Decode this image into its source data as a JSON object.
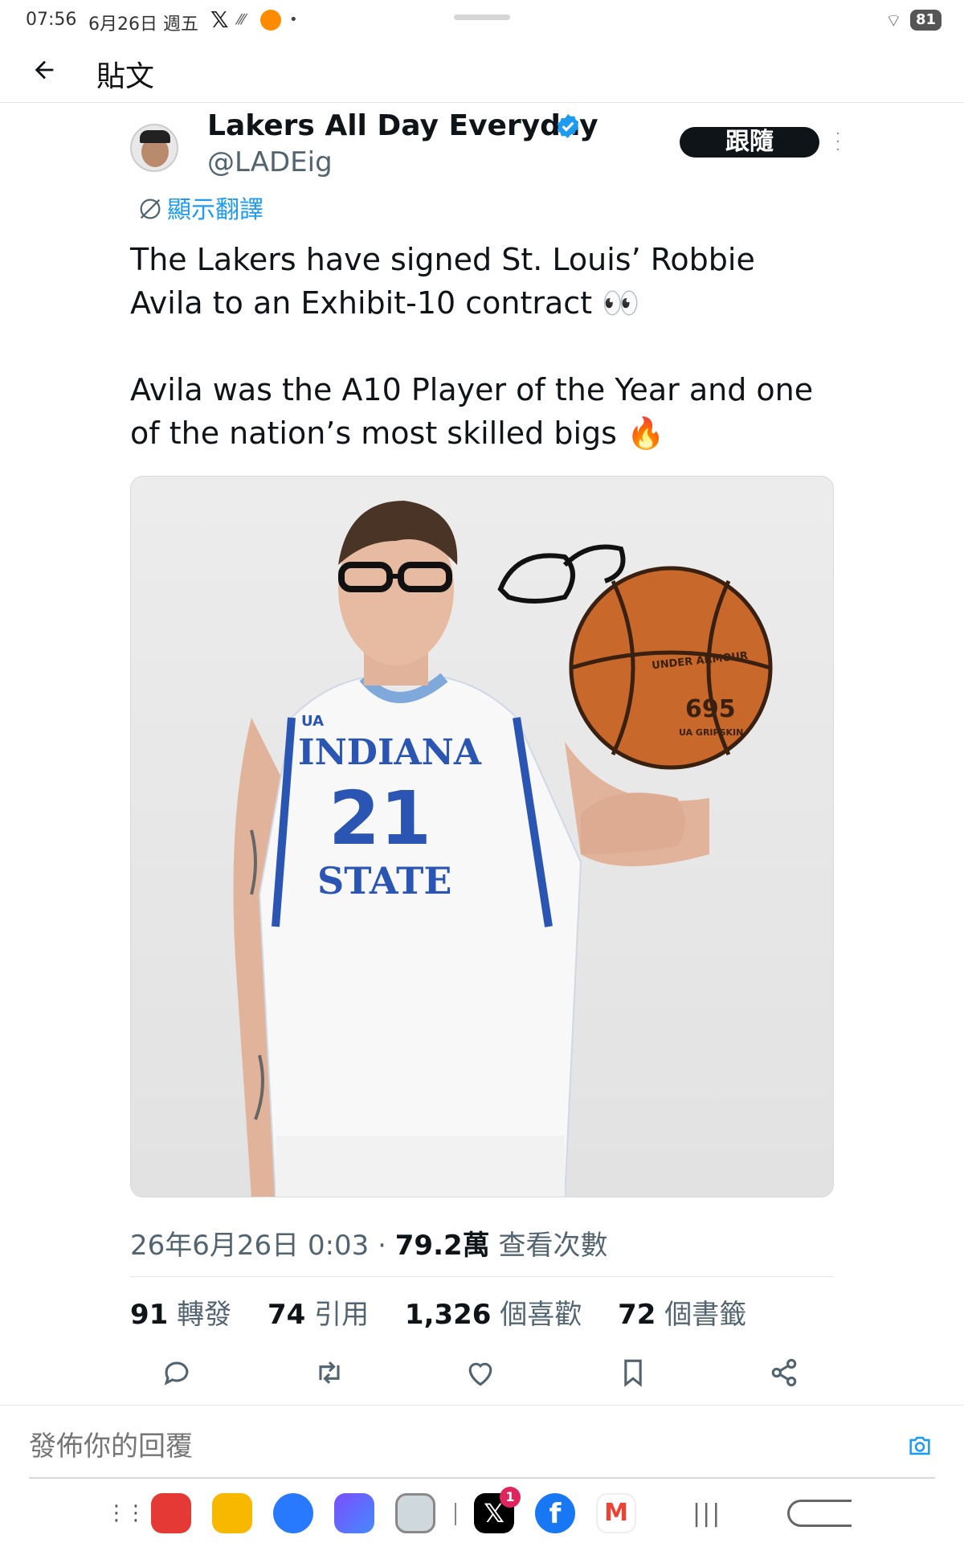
{
  "status_bar": {
    "time": "07:56",
    "date": "6月26日 週五",
    "battery": "81"
  },
  "header": {
    "title": "貼文"
  },
  "author": {
    "name": "Lakers All Day Everyday",
    "handle": "@LADEig",
    "follow_label": "跟隨"
  },
  "translate_label": "顯示翻譯",
  "tweet": {
    "paragraph1": "The Lakers have signed St. Louis’ Robbie Avila to an Exhibit-10 contract 👀",
    "paragraph2": "Avila was the A10 Player of the Year and one of the nation’s most skilled bigs 🔥"
  },
  "media": {
    "jersey_team": "INDIANA",
    "jersey_number": "21",
    "jersey_state": "STATE",
    "ball_brand": "UNDER ARMOUR",
    "ball_model": "695",
    "ball_grip": "UA GRIPSKIN"
  },
  "meta": {
    "timestamp": "26年6月26日 0:03",
    "separator": "·",
    "views": "79.2萬",
    "views_label": "查看次數"
  },
  "stats": {
    "retweets": "91",
    "retweets_label": "轉發",
    "quotes": "74",
    "quotes_label": "引用",
    "likes": "1,326",
    "likes_label": "個喜歡",
    "bookmarks": "72",
    "bookmarks_label": "個書籤"
  },
  "reply": {
    "placeholder": "發佈你的回覆"
  },
  "dock": {
    "x_badge": "1"
  },
  "colors": {
    "accent": "#1d9bf0",
    "text_primary": "#0f1419",
    "text_secondary": "#536471",
    "follow_bg": "#0f1419"
  }
}
